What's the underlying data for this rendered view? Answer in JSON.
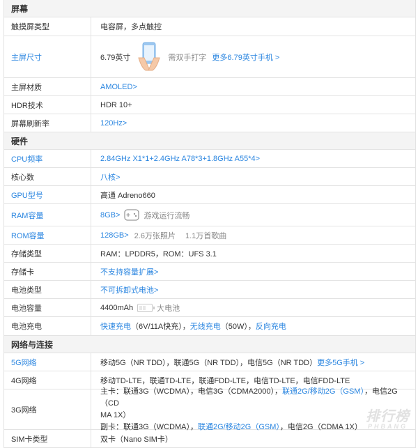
{
  "sections": {
    "screen": "屏幕",
    "hardware": "硬件",
    "network": "网络与连接"
  },
  "rows": {
    "touch": {
      "label": "触摸屏类型",
      "value": "电容屏，多点触控"
    },
    "size": {
      "label": "主屏尺寸",
      "value": "6.79英寸",
      "hint": "需双手打字",
      "more": "更多6.79英寸手机 >"
    },
    "material": {
      "label": "主屏材质",
      "value": "AMOLED>"
    },
    "hdr": {
      "label": "HDR技术",
      "value": "HDR 10+"
    },
    "refresh": {
      "label": "屏幕刷新率",
      "value": "120Hz>"
    },
    "cpu": {
      "label": "CPU频率",
      "value": "2.84GHz X1*1+2.4GHz A78*3+1.8GHz A55*4>"
    },
    "cores": {
      "label": "核心数",
      "value": "八核>"
    },
    "gpu": {
      "label": "GPU型号",
      "value": "高通 Adreno660"
    },
    "ram": {
      "label": "RAM容量",
      "value": "8GB>",
      "hint": "游戏运行流畅"
    },
    "rom": {
      "label": "ROM容量",
      "value": "128GB>",
      "photos": "2.6万张照片",
      "songs": "1.1万首歌曲"
    },
    "storage": {
      "label": "存储类型",
      "value": "RAM：LPDDR5，ROM：UFS 3.1"
    },
    "card": {
      "label": "存储卡",
      "value": "不支持容量扩展>"
    },
    "battype": {
      "label": "电池类型",
      "value": "不可拆卸式电池>"
    },
    "capacity": {
      "label": "电池容量",
      "value": "4400mAh",
      "hint": "大电池"
    },
    "charging": {
      "label": "电池充电",
      "fast": "快速充电",
      "fast_detail": "（6V/11A快充），",
      "wireless": "无线充电",
      "wireless_detail": "（50W），",
      "reverse": "反向充电"
    },
    "g5": {
      "label": "5G网络",
      "value": "移动5G（NR TDD），联通5G（NR TDD），电信5G（NR TDD）",
      "more": "更多5G手机 >"
    },
    "g4": {
      "label": "4G网络",
      "value": "移动TD-LTE，联通TD-LTE，联通FDD-LTE，电信TD-LTE，电信FDD-LTE"
    },
    "g3": {
      "label": "3G网络",
      "main_a": "主卡：联通3G（WCDMA），电信3G（CDMA2000），",
      "main_link": "联通2G/移动2G（GSM）",
      "main_b": "，电信2G（CD",
      "main_c": "MA 1X）",
      "sub_a": "副卡：联通3G（WCDMA），",
      "sub_link": "联通2G/移动2G（GSM）",
      "sub_b": "，电信2G（CDMA 1X）"
    },
    "sim": {
      "label": "SIM卡类型",
      "value": "双卡（Nano SIM卡）"
    }
  },
  "watermark": {
    "main": "排行榜",
    "sub": "PHBANG"
  },
  "colors": {
    "link": "#2b86e0",
    "section_bg": "#f4f4f4",
    "border": "#e3e3e3"
  }
}
